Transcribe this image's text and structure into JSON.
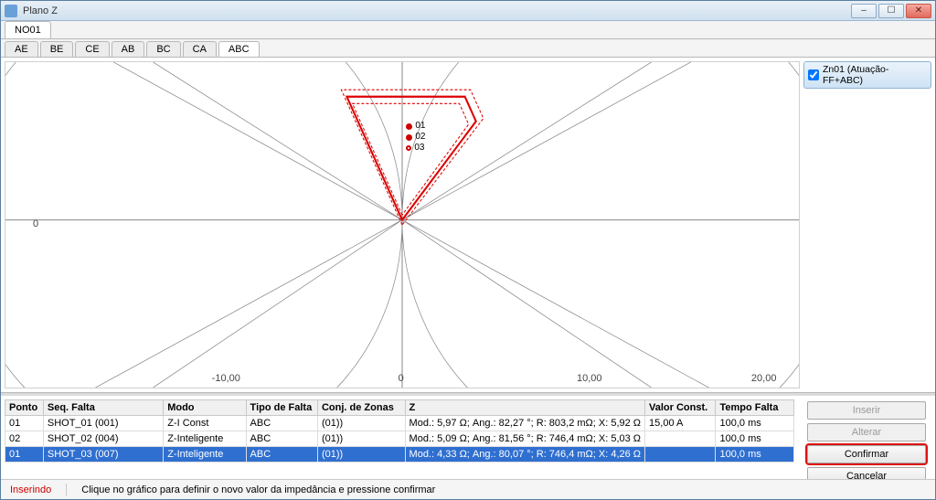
{
  "window": {
    "title": "Plano Z"
  },
  "tabs1": {
    "items": [
      "NO01"
    ],
    "active": 0
  },
  "tabs2": {
    "items": [
      "AE",
      "BE",
      "CE",
      "AB",
      "BC",
      "CA",
      "ABC"
    ],
    "active": 6
  },
  "plot": {
    "y_zero_label": "0",
    "ticks": [
      "-10,00",
      "0",
      "10,00",
      "20,00"
    ],
    "markers": [
      "01",
      "02",
      "03"
    ]
  },
  "legend": {
    "checked": true,
    "label": "Zn01 (Atuação-FF+ABC)"
  },
  "table": {
    "headers": [
      "Ponto",
      "Seq. Falta",
      "Modo",
      "Tipo de Falta",
      "Conj. de Zonas",
      "Z",
      "Valor Const.",
      "Tempo Falta"
    ],
    "rows": [
      {
        "ponto": "01",
        "seq": "SHOT_01 (001)",
        "modo": "Z-I Const",
        "tipo": "ABC",
        "conj": "(01))",
        "z": "Mod.: 5,97 Ω; Ang.: 82,27 °; R: 803,2 mΩ; X: 5,92 Ω",
        "valor": "15,00 A",
        "tempo": "100,0 ms"
      },
      {
        "ponto": "02",
        "seq": "SHOT_02 (004)",
        "modo": "Z-Inteligente",
        "tipo": "ABC",
        "conj": "(01))",
        "z": "Mod.: 5,09 Ω; Ang.: 81,56 °; R: 746,4 mΩ; X: 5,03 Ω",
        "valor": "",
        "tempo": "100,0 ms"
      },
      {
        "ponto": "01",
        "seq": "SHOT_03 (007)",
        "modo": "Z-Inteligente",
        "tipo": "ABC",
        "conj": "(01))",
        "z": "Mod.: 4,33 Ω; Ang.: 80,07 °; R: 746,4 mΩ; X: 4,26 Ω",
        "valor": "",
        "tempo": "100,0 ms"
      }
    ],
    "selected": 2
  },
  "buttons": {
    "insert": "Inserir",
    "edit": "Alterar",
    "confirm": "Confirmar",
    "cancel": "Cancelar"
  },
  "status": {
    "mode": "Inserindo",
    "hint": "Clique no gráfico para definir o novo valor da impedância e pressione confirmar"
  },
  "chart_data": {
    "type": "scatter",
    "title": "",
    "xlabel": "",
    "ylabel": "",
    "xlim": [
      -15,
      22
    ],
    "ylim": [
      -7,
      7
    ],
    "series": [
      {
        "name": "Zn01 (Atuação-FF+ABC)",
        "shape": "polygon",
        "points": [
          [
            0,
            0
          ],
          [
            -3.4,
            5.6
          ],
          [
            3.4,
            5.6
          ],
          [
            0,
            0
          ]
        ]
      }
    ],
    "points": [
      {
        "name": "01",
        "x": 0.8,
        "y": 5.92
      },
      {
        "name": "02",
        "x": 0.75,
        "y": 5.03
      },
      {
        "name": "03",
        "x": 0.75,
        "y": 4.26
      }
    ],
    "x_ticks": [
      -10,
      0,
      10,
      20
    ]
  }
}
